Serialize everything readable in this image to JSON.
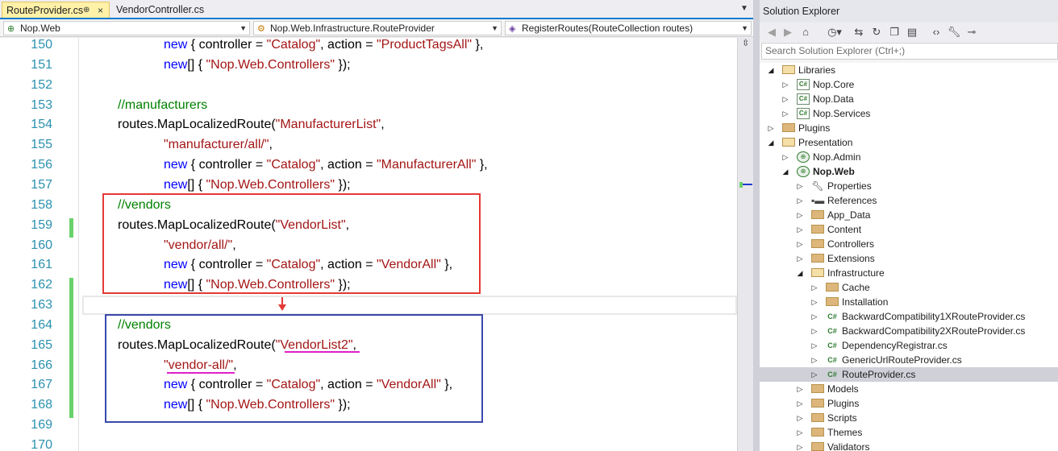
{
  "editor_tabs": [
    {
      "label": "RouteProvider.cs",
      "pin": "⊕",
      "close": "×"
    },
    {
      "label": "VendorController.cs"
    }
  ],
  "nav": {
    "project": "Nop.Web",
    "type": "Nop.Web.Infrastructure.RouteProvider",
    "member": "RegisterRoutes(RouteCollection routes)"
  },
  "code_lines": [
    {
      "num": "150",
      "indent": 2,
      "tokens": [
        [
          "kw",
          "new"
        ],
        [
          "txt",
          " { controller = "
        ],
        [
          "str",
          "\"Catalog\""
        ],
        [
          "txt",
          ", action = "
        ],
        [
          "str",
          "\"ProductTagsAll\""
        ],
        [
          "txt",
          " },"
        ]
      ]
    },
    {
      "num": "151",
      "indent": 2,
      "tokens": [
        [
          "kw",
          "new"
        ],
        [
          "txt",
          "[] { "
        ],
        [
          "str",
          "\"Nop.Web.Controllers\""
        ],
        [
          "txt",
          " });"
        ]
      ]
    },
    {
      "num": "152",
      "indent": 0,
      "tokens": []
    },
    {
      "num": "153",
      "indent": 0,
      "tokens": [
        [
          "cmt",
          "//manufacturers"
        ]
      ]
    },
    {
      "num": "154",
      "indent": 0,
      "tokens": [
        [
          "txt",
          "routes.MapLocalizedRoute("
        ],
        [
          "str",
          "\"ManufacturerList\""
        ],
        [
          "txt",
          ","
        ]
      ]
    },
    {
      "num": "155",
      "indent": 2,
      "tokens": [
        [
          "str",
          "\"manufacturer/all/\""
        ],
        [
          "txt",
          ","
        ]
      ]
    },
    {
      "num": "156",
      "indent": 2,
      "tokens": [
        [
          "kw",
          "new"
        ],
        [
          "txt",
          " { controller = "
        ],
        [
          "str",
          "\"Catalog\""
        ],
        [
          "txt",
          ", action = "
        ],
        [
          "str",
          "\"ManufacturerAll\""
        ],
        [
          "txt",
          " },"
        ]
      ]
    },
    {
      "num": "157",
      "indent": 2,
      "tokens": [
        [
          "kw",
          "new"
        ],
        [
          "txt",
          "[] { "
        ],
        [
          "str",
          "\"Nop.Web.Controllers\""
        ],
        [
          "txt",
          " });"
        ]
      ]
    },
    {
      "num": "158",
      "indent": 0,
      "tokens": [
        [
          "cmt",
          "//vendors"
        ]
      ]
    },
    {
      "num": "159",
      "indent": 0,
      "tokens": [
        [
          "txt",
          "routes.MapLocalizedRoute("
        ],
        [
          "str",
          "\"VendorList\""
        ],
        [
          "txt",
          ","
        ]
      ]
    },
    {
      "num": "160",
      "indent": 2,
      "tokens": [
        [
          "str",
          "\"vendor/all/\""
        ],
        [
          "txt",
          ","
        ]
      ]
    },
    {
      "num": "161",
      "indent": 2,
      "tokens": [
        [
          "kw",
          "new"
        ],
        [
          "txt",
          " { controller = "
        ],
        [
          "str",
          "\"Catalog\""
        ],
        [
          "txt",
          ", action = "
        ],
        [
          "str",
          "\"VendorAll\""
        ],
        [
          "txt",
          " },"
        ]
      ]
    },
    {
      "num": "162",
      "indent": 2,
      "tokens": [
        [
          "kw",
          "new"
        ],
        [
          "txt",
          "[] { "
        ],
        [
          "str",
          "\"Nop.Web.Controllers\""
        ],
        [
          "txt",
          " });"
        ]
      ]
    },
    {
      "num": "163",
      "indent": 0,
      "tokens": []
    },
    {
      "num": "164",
      "indent": 0,
      "tokens": [
        [
          "cmt",
          "//vendors"
        ]
      ]
    },
    {
      "num": "165",
      "indent": 0,
      "tokens": [
        [
          "txt",
          "routes.MapLocalizedRoute("
        ],
        [
          "str",
          "\"VendorList2\""
        ],
        [
          "txt",
          ","
        ]
      ]
    },
    {
      "num": "166",
      "indent": 2,
      "tokens": [
        [
          "str",
          "\"vendor-all/\""
        ],
        [
          "txt",
          ","
        ]
      ]
    },
    {
      "num": "167",
      "indent": 2,
      "tokens": [
        [
          "kw",
          "new"
        ],
        [
          "txt",
          " { controller = "
        ],
        [
          "str",
          "\"Catalog\""
        ],
        [
          "txt",
          ", action = "
        ],
        [
          "str",
          "\"VendorAll\""
        ],
        [
          "txt",
          " },"
        ]
      ]
    },
    {
      "num": "168",
      "indent": 2,
      "tokens": [
        [
          "kw",
          "new"
        ],
        [
          "txt",
          "[] { "
        ],
        [
          "str",
          "\"Nop.Web.Controllers\""
        ],
        [
          "txt",
          " });"
        ]
      ]
    },
    {
      "num": "169",
      "indent": 0,
      "tokens": []
    },
    {
      "num": "170",
      "indent": 0,
      "tokens": []
    }
  ],
  "changed_lines": [
    "159",
    "162",
    "163",
    "164",
    "165",
    "166",
    "167",
    "168"
  ],
  "annotation_colors": {
    "original_box": "#e53935",
    "copy_box": "#3949ab",
    "underline": "#e020c8",
    "arrow": "#e53935"
  },
  "solution_explorer": {
    "title": "Solution Explorer",
    "search_placeholder": "Search Solution Explorer (Ctrl+;)",
    "toolbar_icons": [
      "back-icon",
      "forward-icon",
      "home-icon",
      "history-icon",
      "sync-icon",
      "collapse-icon",
      "copy-icon",
      "properties-icon",
      "code-icon",
      "wrench-icon",
      "pin-icon"
    ],
    "tree": [
      {
        "label": "Libraries",
        "depth": 0,
        "expander": "open",
        "icon": "folder-open"
      },
      {
        "label": "Nop.Core",
        "depth": 1,
        "expander": "closed",
        "icon": "cs-project"
      },
      {
        "label": "Nop.Data",
        "depth": 1,
        "expander": "closed",
        "icon": "cs-project"
      },
      {
        "label": "Nop.Services",
        "depth": 1,
        "expander": "closed",
        "icon": "cs-project"
      },
      {
        "label": "Plugins",
        "depth": 0,
        "expander": "closed",
        "icon": "folder"
      },
      {
        "label": "Presentation",
        "depth": 0,
        "expander": "open",
        "icon": "folder-open"
      },
      {
        "label": "Nop.Admin",
        "depth": 1,
        "expander": "closed",
        "icon": "web-project"
      },
      {
        "label": "Nop.Web",
        "depth": 1,
        "expander": "open",
        "icon": "web-project",
        "bold": true
      },
      {
        "label": "Properties",
        "depth": 2,
        "expander": "closed",
        "icon": "wrench"
      },
      {
        "label": "References",
        "depth": 2,
        "expander": "closed",
        "icon": "references"
      },
      {
        "label": "App_Data",
        "depth": 2,
        "expander": "closed",
        "icon": "folder"
      },
      {
        "label": "Content",
        "depth": 2,
        "expander": "closed",
        "icon": "folder"
      },
      {
        "label": "Controllers",
        "depth": 2,
        "expander": "closed",
        "icon": "folder"
      },
      {
        "label": "Extensions",
        "depth": 2,
        "expander": "closed",
        "icon": "folder"
      },
      {
        "label": "Infrastructure",
        "depth": 2,
        "expander": "open",
        "icon": "folder-open"
      },
      {
        "label": "Cache",
        "depth": 3,
        "expander": "closed",
        "icon": "folder"
      },
      {
        "label": "Installation",
        "depth": 3,
        "expander": "closed",
        "icon": "folder"
      },
      {
        "label": "BackwardCompatibility1XRouteProvider.cs",
        "depth": 3,
        "expander": "closed",
        "icon": "cs-file"
      },
      {
        "label": "BackwardCompatibility2XRouteProvider.cs",
        "depth": 3,
        "expander": "closed",
        "icon": "cs-file"
      },
      {
        "label": "DependencyRegistrar.cs",
        "depth": 3,
        "expander": "closed",
        "icon": "cs-file"
      },
      {
        "label": "GenericUrlRouteProvider.cs",
        "depth": 3,
        "expander": "closed",
        "icon": "cs-file"
      },
      {
        "label": "RouteProvider.cs",
        "depth": 3,
        "expander": "closed",
        "icon": "cs-file",
        "selected": true
      },
      {
        "label": "Models",
        "depth": 2,
        "expander": "closed",
        "icon": "folder"
      },
      {
        "label": "Plugins",
        "depth": 2,
        "expander": "closed",
        "icon": "folder"
      },
      {
        "label": "Scripts",
        "depth": 2,
        "expander": "closed",
        "icon": "folder"
      },
      {
        "label": "Themes",
        "depth": 2,
        "expander": "closed",
        "icon": "folder"
      },
      {
        "label": "Validators",
        "depth": 2,
        "expander": "closed",
        "icon": "folder"
      }
    ]
  }
}
